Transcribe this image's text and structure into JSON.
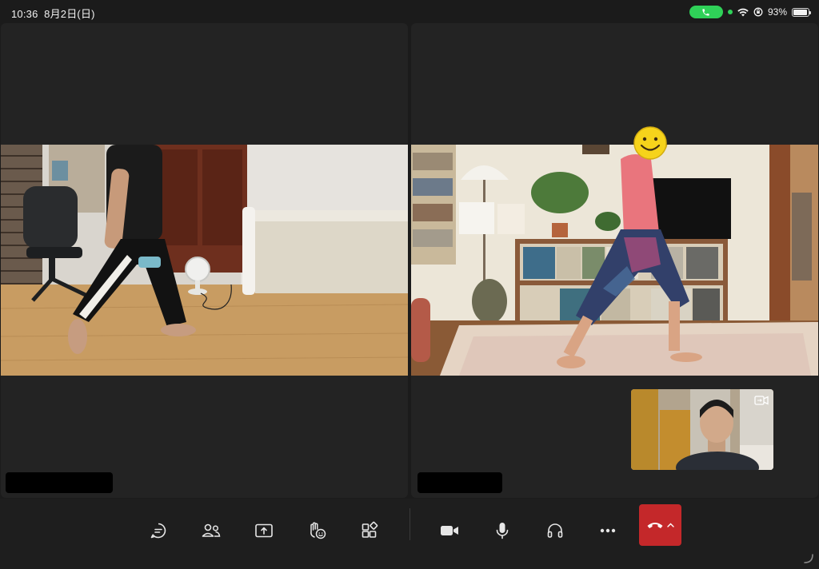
{
  "status_bar": {
    "time": "10:36",
    "date": "8月2日(日)",
    "battery_percent": "93%",
    "battery_level": 0.93,
    "accent_call": "#2fd158"
  },
  "participants": [
    {
      "position": "left",
      "name_hidden": true,
      "video": "participant-video-room-with-chair-and-bed"
    },
    {
      "position": "right",
      "name_hidden": true,
      "video": "participant-video-living-room-with-bookshelf"
    }
  ],
  "self_view": {
    "switch_icon": "switch-camera-icon"
  },
  "toolbar": {
    "items": [
      {
        "icon": "chat-icon"
      },
      {
        "icon": "people-icon"
      },
      {
        "icon": "share-screen-icon"
      },
      {
        "icon": "reactions-icon"
      },
      {
        "icon": "apps-icon"
      },
      {
        "icon": "camera-icon"
      },
      {
        "icon": "microphone-icon"
      },
      {
        "icon": "headset-icon"
      },
      {
        "icon": "more-icon"
      }
    ],
    "hangup": {
      "icon": "hang-up-icon",
      "color": "#c4282a"
    }
  }
}
